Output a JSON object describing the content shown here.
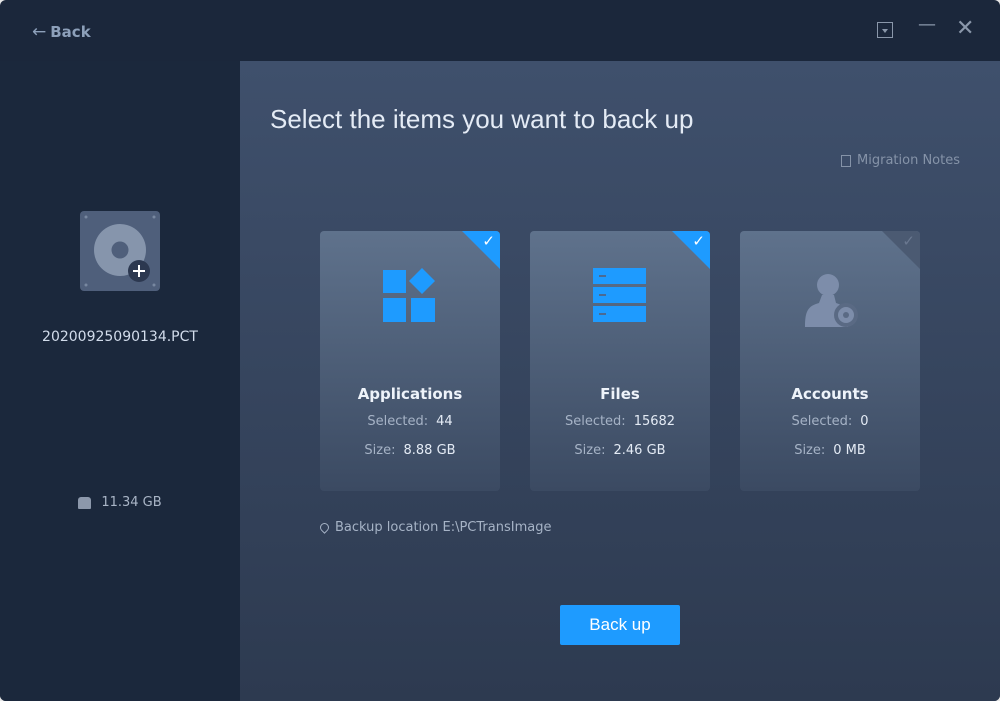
{
  "titlebar": {
    "back_label": "Back"
  },
  "sidebar": {
    "image_name": "20200925090134.PCT",
    "size": "11.34 GB"
  },
  "main": {
    "title": "Select the items you want to back up",
    "migration_notes": "Migration Notes",
    "selected_label": "Selected:",
    "size_label": "Size:",
    "cards": [
      {
        "name": "Applications",
        "selected": "44",
        "size": "8.88 GB",
        "checked": true
      },
      {
        "name": "Files",
        "selected": "15682",
        "size": "2.46 GB",
        "checked": true
      },
      {
        "name": "Accounts",
        "selected": "0",
        "size": "0 MB",
        "checked": false
      }
    ],
    "backup_location": "Backup location E:\\PCTransImage",
    "backup_button": "Back up"
  },
  "colors": {
    "accent": "#1e9bff",
    "background": "#1b273b"
  }
}
